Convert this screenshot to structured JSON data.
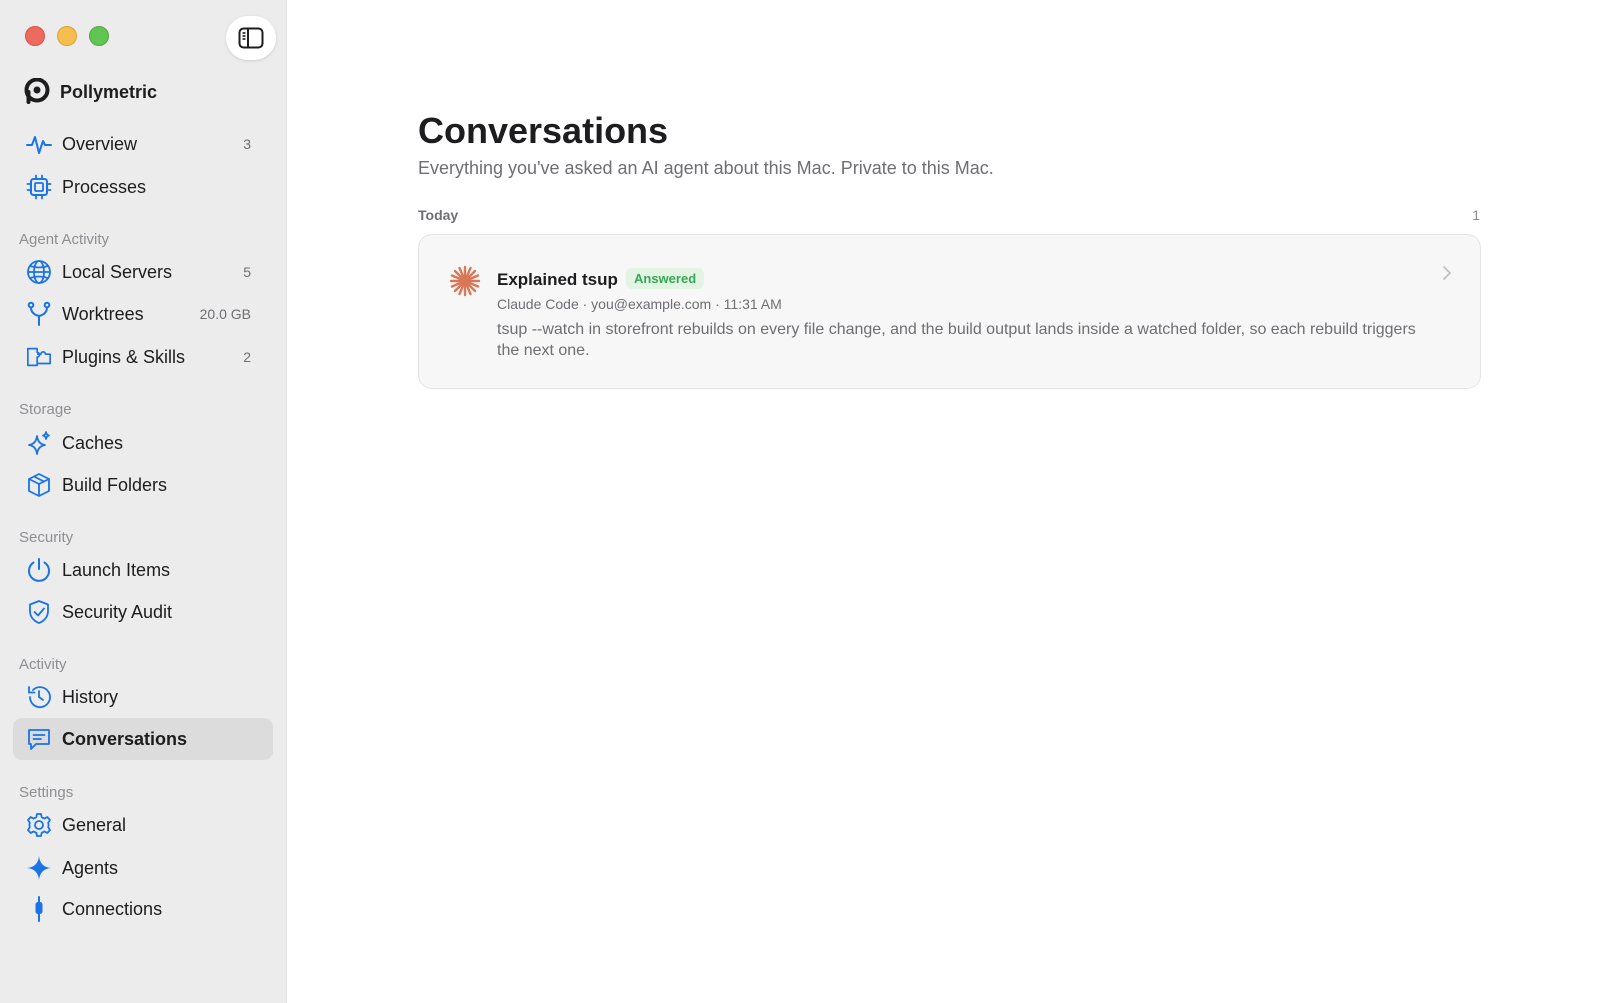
{
  "app": {
    "brand_name": "Pollymetric"
  },
  "sidebar": {
    "top_items": [
      {
        "label": "Overview",
        "badge": "3",
        "icon": "pulse-icon"
      },
      {
        "label": "Processes",
        "badge": "",
        "icon": "cpu-icon"
      }
    ],
    "sections": [
      {
        "label": "Agent Activity",
        "items": [
          {
            "label": "Local Servers",
            "badge": "5",
            "icon": "globe-icon"
          },
          {
            "label": "Worktrees",
            "badge": "20.0 GB",
            "icon": "branch-icon"
          },
          {
            "label": "Plugins & Skills",
            "badge": "2",
            "icon": "plugin-icon"
          }
        ]
      },
      {
        "label": "Storage",
        "items": [
          {
            "label": "Caches",
            "badge": "",
            "icon": "sparkles-icon"
          },
          {
            "label": "Build Folders",
            "badge": "",
            "icon": "cube-icon"
          }
        ]
      },
      {
        "label": "Security",
        "items": [
          {
            "label": "Launch Items",
            "badge": "",
            "icon": "power-icon"
          },
          {
            "label": "Security Audit",
            "badge": "",
            "icon": "shield-check-icon"
          }
        ]
      },
      {
        "label": "Activity",
        "items": [
          {
            "label": "History",
            "badge": "",
            "icon": "history-icon"
          },
          {
            "label": "Conversations",
            "badge": "",
            "icon": "chat-icon",
            "active": true
          }
        ]
      },
      {
        "label": "Settings",
        "items": [
          {
            "label": "General",
            "badge": "",
            "icon": "gear-icon"
          },
          {
            "label": "Agents",
            "badge": "",
            "icon": "sparkle-icon"
          },
          {
            "label": "Connections",
            "badge": "",
            "icon": "plug-icon"
          }
        ]
      }
    ]
  },
  "main": {
    "title": "Conversations",
    "subtitle": "Everything you've asked an AI agent about this Mac. Private to this Mac.",
    "group": {
      "label": "Today",
      "count": "1",
      "items": [
        {
          "title": "Explained tsup",
          "status": "Answered",
          "meta": "Claude Code · you@example.com · 11:31 AM",
          "snippet": "tsup --watch in storefront rebuilds on every file change, and the build output lands inside a watched folder, so each rebuild triggers the next one.",
          "agent_icon": "claude-starburst-icon"
        }
      ]
    }
  },
  "colors": {
    "accent": "#1a73e8",
    "sidebar_bg": "#ececec",
    "active_item_bg": "#dcdcdc",
    "answered_green": "#34a853",
    "claude_orange": "#d97757"
  }
}
